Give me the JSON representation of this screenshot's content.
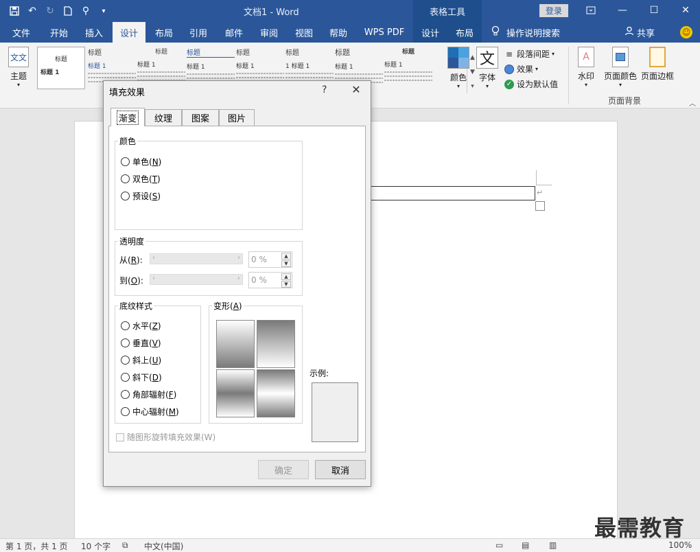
{
  "titlebar": {
    "doc_title": "文档1  -  Word",
    "context_group": "表格工具",
    "login": "登录",
    "qat_icons": [
      "save-icon",
      "undo-icon",
      "redo-icon",
      "new-doc-icon",
      "touch-mode-icon",
      "customize-qat-icon"
    ]
  },
  "tabs": {
    "file": "文件",
    "home": "开始",
    "insert": "插入",
    "design": "设计",
    "layout": "布局",
    "references": "引用",
    "mailings": "邮件",
    "review": "审阅",
    "view": "视图",
    "help": "帮助",
    "wps_pdf": "WPS PDF",
    "table_design": "设计",
    "table_layout": "布局",
    "tell_me": "操作说明搜索",
    "share": "共享"
  },
  "ribbon": {
    "themes": "主题",
    "colors": "颜色",
    "fonts": "字体",
    "font_glyph": "文",
    "paragraph_spacing": "段落间距",
    "effects": "效果",
    "set_default": "设为默认值",
    "watermark": "水印",
    "page_color": "页面颜色",
    "page_borders": "页面边框",
    "page_background_group": "页面背景",
    "gallery": [
      {
        "title": "标题",
        "sub": "标题 1"
      },
      {
        "title": "标题",
        "sub": "标题 1"
      },
      {
        "title": "标题",
        "sub": "标题 1"
      },
      {
        "title": "标题",
        "sub": "标题 1"
      },
      {
        "title": "标题",
        "sub": "标题 1"
      },
      {
        "title": "标题",
        "sub": "1  标题 1"
      },
      {
        "title": "标题",
        "sub": "标题 1"
      },
      {
        "title": "标题",
        "sub": "标题 1"
      }
    ]
  },
  "dialog": {
    "title": "填充效果",
    "help": "?",
    "tabs": [
      "渐变",
      "纹理",
      "图案",
      "图片"
    ],
    "colors": {
      "legend": "颜色",
      "options": [
        {
          "label": "单色(",
          "key": "N",
          "end": ")"
        },
        {
          "label": "双色(",
          "key": "T",
          "end": ")"
        },
        {
          "label": "预设(",
          "key": "S",
          "end": ")"
        }
      ]
    },
    "transparency": {
      "legend": "透明度",
      "from_label": "从(",
      "from_key": "R",
      "from_end": "):",
      "to_label": "到(",
      "to_key": "O",
      "to_end": "):",
      "from_value": "0 %",
      "to_value": "0 %"
    },
    "shading": {
      "legend": "底纹样式",
      "options": [
        {
          "label": "水平(",
          "key": "Z",
          "end": ")"
        },
        {
          "label": "垂直(",
          "key": "V",
          "end": ")"
        },
        {
          "label": "斜上(",
          "key": "U",
          "end": ")"
        },
        {
          "label": "斜下(",
          "key": "D",
          "end": ")"
        },
        {
          "label": "角部辐射(",
          "key": "F",
          "end": ")"
        },
        {
          "label": "中心辐射(",
          "key": "M",
          "end": ")"
        }
      ]
    },
    "variants": {
      "legend_label": "变形(",
      "legend_key": "A",
      "legend_end": ")"
    },
    "sample_label": "示例:",
    "rotate_checkbox": "随图形旋转填充效果(W)",
    "ok": "确定",
    "cancel": "取消"
  },
  "statusbar": {
    "page": "第 1 页，共 1 页",
    "words": "10 个字",
    "language": "中文(中国)",
    "zoom": "100%"
  },
  "watermark_text": "最需教育"
}
